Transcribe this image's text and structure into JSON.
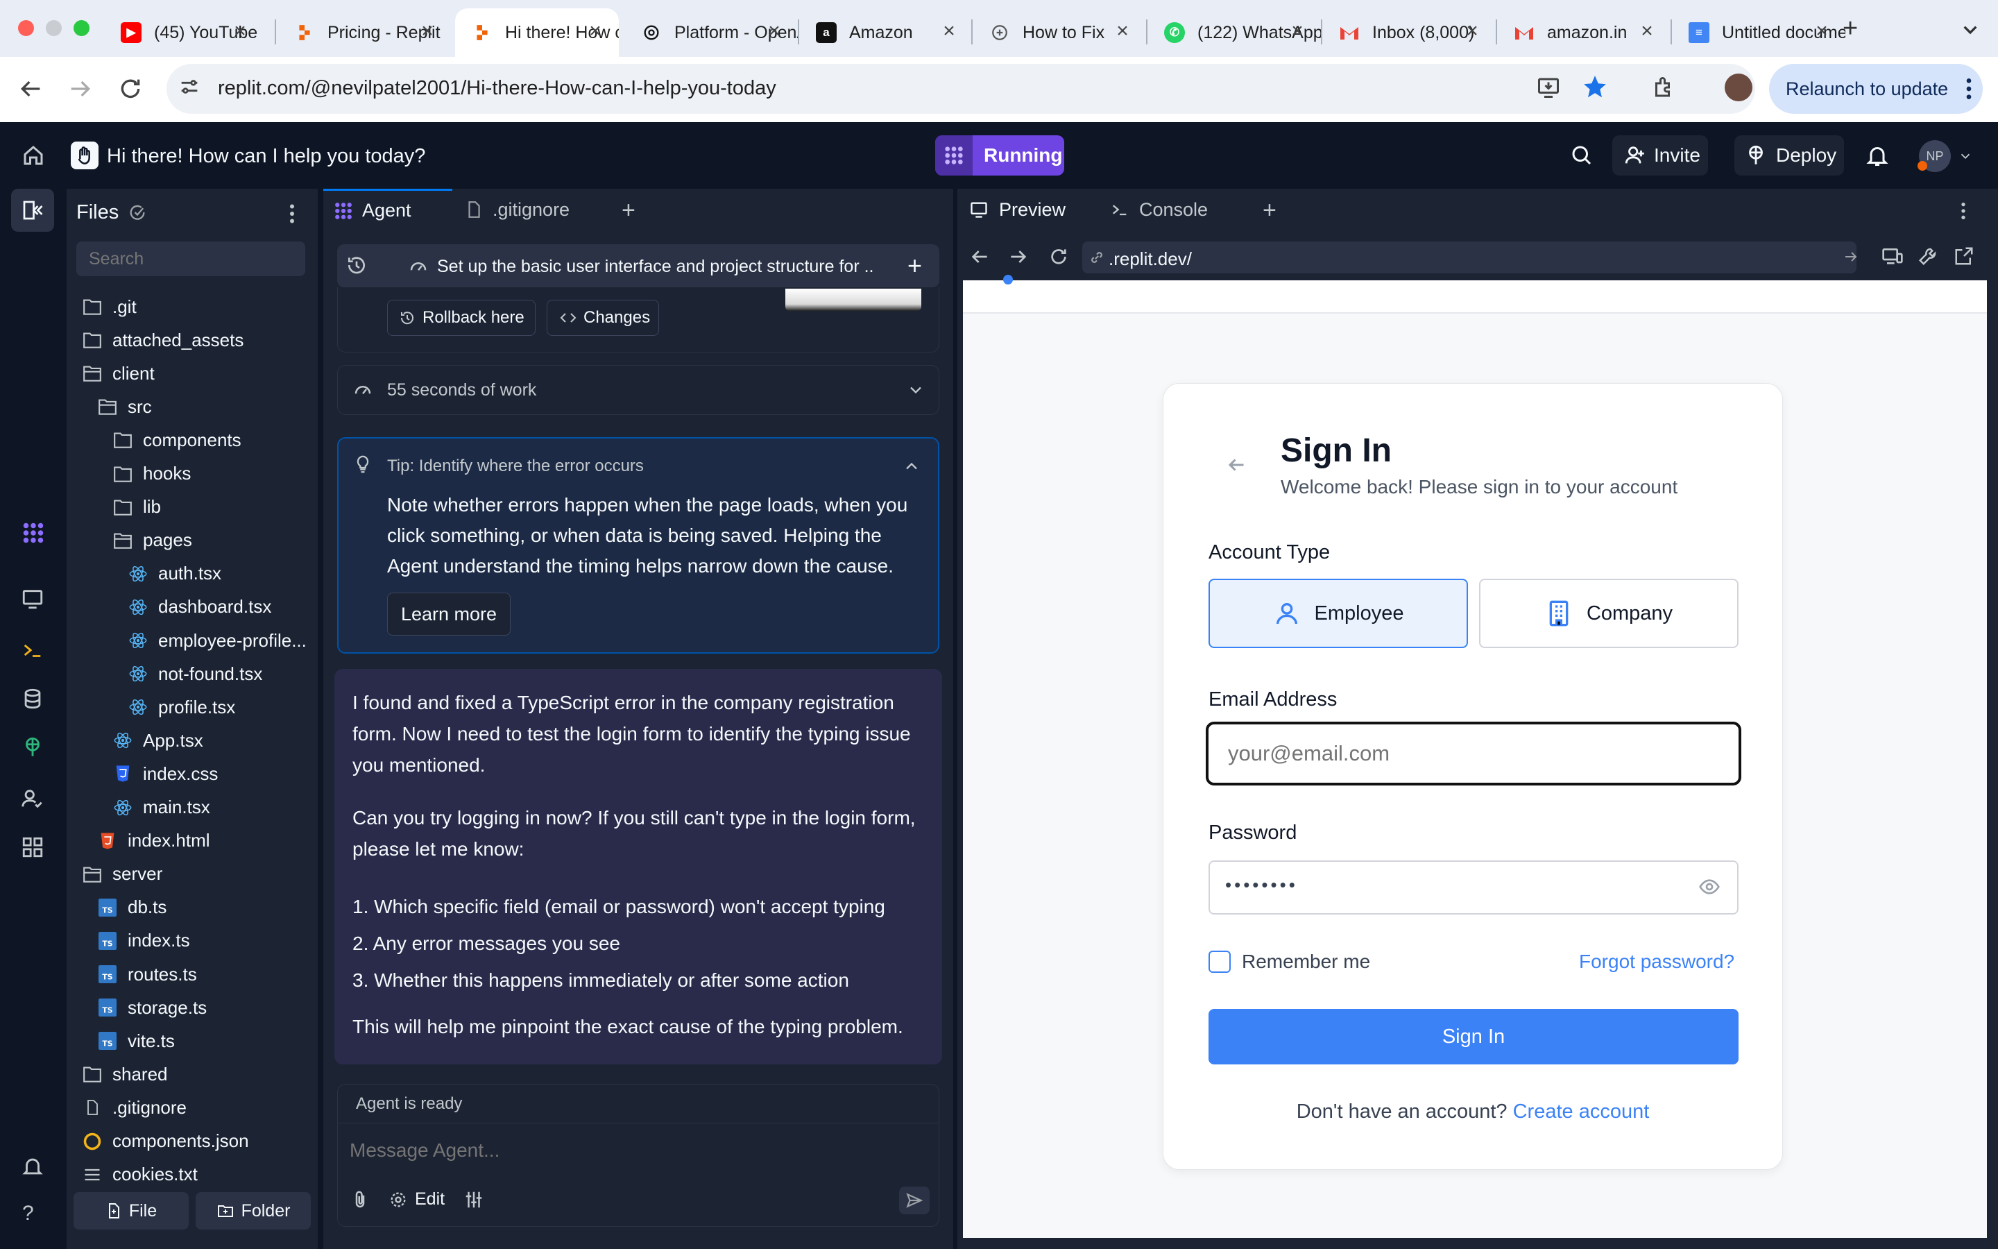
{
  "browser": {
    "tabs": [
      {
        "title": "(45) YouTube",
        "favicon": "youtube"
      },
      {
        "title": "Pricing - Replit",
        "favicon": "replit"
      },
      {
        "title": "Hi there! How can I help",
        "favicon": "replit",
        "active": true
      },
      {
        "title": "Platform - OpenAI",
        "favicon": "openai"
      },
      {
        "title": "Amazon",
        "favicon": "amazon"
      },
      {
        "title": "How to Fix",
        "favicon": "generic"
      },
      {
        "title": "(122) WhatsApp",
        "favicon": "whatsapp"
      },
      {
        "title": "Inbox (8,000)",
        "favicon": "gmail"
      },
      {
        "title": "amazon.in",
        "favicon": "gmail"
      },
      {
        "title": "Untitled document",
        "favicon": "docs"
      }
    ],
    "url": "replit.com/@nevilpatel2001/Hi-there-How-can-I-help-you-today",
    "relaunch_label": "Relaunch to update"
  },
  "topbar": {
    "project_title": "Hi there! How can I help you today?",
    "run_label": "Running",
    "invite_label": "Invite",
    "deploy_label": "Deploy",
    "avatar_initials": "NP"
  },
  "files": {
    "title": "Files",
    "search_placeholder": "Search",
    "tree": [
      {
        "name": ".git",
        "type": "folder",
        "depth": 0
      },
      {
        "name": "attached_assets",
        "type": "folder",
        "depth": 0
      },
      {
        "name": "client",
        "type": "folder-open",
        "depth": 0
      },
      {
        "name": "src",
        "type": "folder-open",
        "depth": 1
      },
      {
        "name": "components",
        "type": "folder",
        "depth": 2
      },
      {
        "name": "hooks",
        "type": "folder",
        "depth": 2
      },
      {
        "name": "lib",
        "type": "folder",
        "depth": 2
      },
      {
        "name": "pages",
        "type": "folder-open",
        "depth": 2
      },
      {
        "name": "auth.tsx",
        "type": "react",
        "depth": 3
      },
      {
        "name": "dashboard.tsx",
        "type": "react",
        "depth": 3
      },
      {
        "name": "employee-profile...",
        "type": "react",
        "depth": 3
      },
      {
        "name": "not-found.tsx",
        "type": "react",
        "depth": 3
      },
      {
        "name": "profile.tsx",
        "type": "react",
        "depth": 3
      },
      {
        "name": "App.tsx",
        "type": "react",
        "depth": 2
      },
      {
        "name": "index.css",
        "type": "css",
        "depth": 2
      },
      {
        "name": "main.tsx",
        "type": "react",
        "depth": 2
      },
      {
        "name": "index.html",
        "type": "html",
        "depth": 1
      },
      {
        "name": "server",
        "type": "folder-open",
        "depth": 0
      },
      {
        "name": "db.ts",
        "type": "ts",
        "depth": 1
      },
      {
        "name": "index.ts",
        "type": "ts",
        "depth": 1
      },
      {
        "name": "routes.ts",
        "type": "ts",
        "depth": 1
      },
      {
        "name": "storage.ts",
        "type": "ts",
        "depth": 1
      },
      {
        "name": "vite.ts",
        "type": "ts",
        "depth": 1
      },
      {
        "name": "shared",
        "type": "folder",
        "depth": 0
      },
      {
        "name": ".gitignore",
        "type": "file",
        "depth": 0
      },
      {
        "name": "components.json",
        "type": "json",
        "depth": 0
      },
      {
        "name": "cookies.txt",
        "type": "text",
        "depth": 0
      }
    ],
    "new_file_label": "File",
    "new_folder_label": "Folder"
  },
  "agent": {
    "tab_agent": "Agent",
    "tab_gitignore": ".gitignore",
    "checkpoint_title": "Set up the basic user interface and project structure for ...",
    "rollback_label": "Rollback here",
    "changes_label": "Changes",
    "work_summary": "55 seconds of work",
    "tip_title": "Tip: Identify where the error occurs",
    "tip_body": "Note whether errors happen when the page loads, when you click something, or when data is being saved. Helping the Agent understand the timing helps narrow down the cause.",
    "learn_more": "Learn more",
    "message_p1": "I found and fixed a TypeScript error in the company registration form. Now I need to test the login form to identify the typing issue you mentioned.",
    "message_p2": "Can you try logging in now? If you still can't type in the login form, please let me know:",
    "message_list": [
      "1. Which specific field (email or password) won't accept typing",
      "2. Any error messages you see",
      "3. Whether this happens immediately or after some action"
    ],
    "message_p3": "This will help me pinpoint the exact cause of the typing problem.",
    "status": "Agent is ready",
    "input_placeholder": "Message Agent...",
    "edit_label": "Edit"
  },
  "preview": {
    "tab_preview": "Preview",
    "tab_console": "Console",
    "address": ".replit.dev/",
    "signin": {
      "title": "Sign In",
      "subtitle": "Welcome back! Please sign in to your account",
      "account_type_label": "Account Type",
      "employee_label": "Employee",
      "company_label": "Company",
      "email_label": "Email Address",
      "email_placeholder": "your@email.com",
      "password_label": "Password",
      "password_value": "••••••••",
      "remember_label": "Remember me",
      "forgot_label": "Forgot password?",
      "submit_label": "Sign In",
      "no_account_text": "Don't have an account?",
      "create_account_label": "Create account"
    }
  },
  "colors": {
    "accent_blue": "#3b82f6",
    "replit_purple": "#6e45e2",
    "panel_bg": "#1c2333",
    "app_bg": "#0e1525"
  }
}
